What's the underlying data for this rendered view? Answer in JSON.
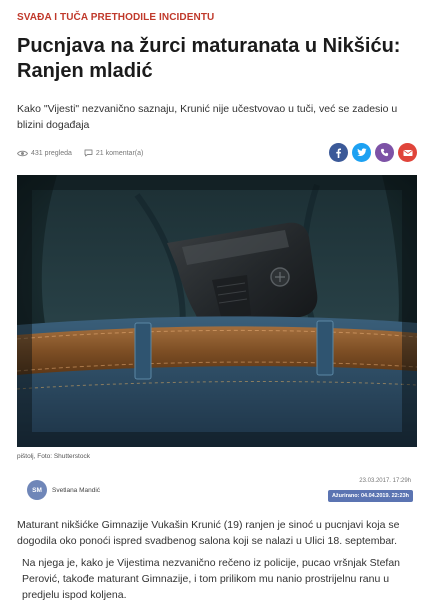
{
  "article": {
    "kicker": "SVAĐA I TUČA PRETHODILE INCIDENTU",
    "title": "Pucnjava na žurci maturanata u Nikšiću: Ranjen mladić",
    "lead": "Kako \"Vijesti\" nezvanično saznaju, Krunić nije učestvovao u tuči, već se zadesio u blizini događaja",
    "views": "431 pregleda",
    "comments": "21 komentar(a)",
    "photo_caption": "pištolj, Foto: Shutterstock",
    "author_initials": "SM",
    "author_name": "Svetlana Mandić",
    "published": "23.03.2017. 17:29h",
    "updated": "Ažurirano: 04.04.2019. 22:23h",
    "paragraphs": [
      "Maturant nikšićke Gimnazije Vukašin Krunić (19) ranjen je sinoć u pucnjavi koja se dogodila oko ponoći ispred svadbenog salona koji se nalazi u Ulici 18. septembar.",
      "Na njega je, kako je Vijestima nezvanično rečeno iz policije, pucao vršnjak Stefan Perović, takođe maturant Gimnazije, i tom prilikom mu nanio prostrijelnu ranu u predjelu ispod koljena."
    ]
  },
  "share": [
    {
      "name": "facebook",
      "color": "#3b5998"
    },
    {
      "name": "twitter",
      "color": "#1da1f2"
    },
    {
      "name": "viber",
      "color": "#7d52a6"
    },
    {
      "name": "email",
      "color": "#e0443a"
    }
  ],
  "colors": {
    "kicker": "#c0392b",
    "badge": "#5b74b2"
  }
}
